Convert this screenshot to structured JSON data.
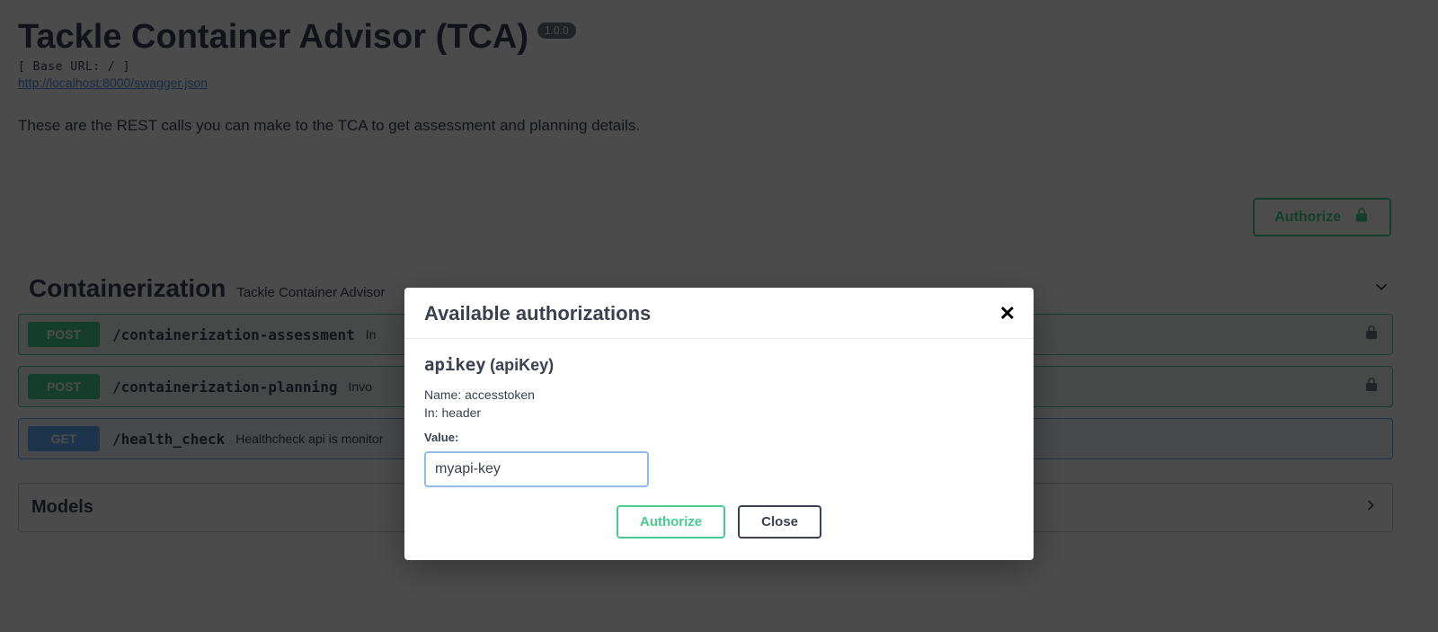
{
  "header": {
    "title": "Tackle Container Advisor (TCA)",
    "version": "1.0.0",
    "base_url_label": "[ Base URL: / ]",
    "swagger_url": "http://localhost:8000/swagger.json",
    "description": "These are the REST calls you can make to the TCA to get assessment and planning details."
  },
  "authorize_button": "Authorize",
  "section": {
    "title": "Containerization",
    "subtitle": "Tackle Container Advisor"
  },
  "operations": [
    {
      "method": "POST",
      "path": "/containerization-assessment",
      "summary": "In"
    },
    {
      "method": "POST",
      "path": "/containerization-planning",
      "summary": "Invo"
    },
    {
      "method": "GET",
      "path": "/health_check",
      "summary": "Healthcheck api is monitor"
    }
  ],
  "models_label": "Models",
  "modal": {
    "title": "Available authorizations",
    "auth_name": "apikey",
    "auth_type": "(apiKey)",
    "name_label": "Name:",
    "name_value": "accesstoken",
    "in_label": "In:",
    "in_value": "header",
    "value_label": "Value:",
    "input_value": "myapi-key",
    "authorize_button": "Authorize",
    "close_button": "Close"
  }
}
